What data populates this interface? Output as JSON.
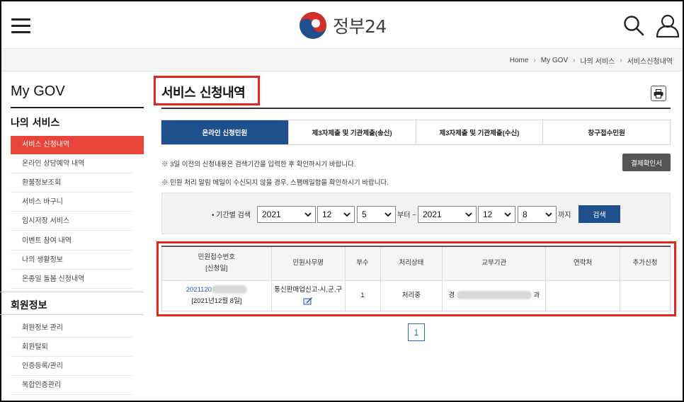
{
  "header": {
    "logo_text": "정부24",
    "colors": {
      "brand_red": "#d22f27",
      "brand_blue": "#1f4f8c"
    }
  },
  "breadcrumb": [
    "Home",
    "My GOV",
    "나의 서비스",
    "서비스신청내역"
  ],
  "sidebar": {
    "title": "My GOV",
    "section_service": "나의 서비스",
    "service_items": [
      {
        "label": "서비스 신청내역",
        "active": true
      },
      {
        "label": "온라인 상담예약 내역"
      },
      {
        "label": "환불정보조회"
      },
      {
        "label": "서비스 바구니"
      },
      {
        "label": "임시저장 서비스"
      },
      {
        "label": "이벤트 참여 내역"
      },
      {
        "label": "나의 생활정보"
      },
      {
        "label": "온종일 돌봄 신청내역"
      }
    ],
    "section_member": "회원정보",
    "member_items": [
      {
        "label": "회원정보 관리"
      },
      {
        "label": "회원탈퇴"
      },
      {
        "label": "인증등록/관리"
      },
      {
        "label": "복합인증관리"
      }
    ]
  },
  "main": {
    "page_title": "서비스 신청내역",
    "tabs": [
      {
        "label": "온라인 신청민원",
        "active": true
      },
      {
        "label": "제3자제출 및 기관제출(송신)"
      },
      {
        "label": "제3자제출 및 기관제출(수신)"
      },
      {
        "label": "창구접수민원"
      }
    ],
    "notice1": "※ 3일 이전의 신청내용은 검색기간을 입력한 후 확인하시기 바랍니다.",
    "notice2": "※ 민원 처리 알림 메일이 수신되지 않을 경우, 스팸메일함을 확인하시기 바랍니다.",
    "receipt_button": "결제확인서",
    "search": {
      "label": "• 기간별 검색",
      "from": {
        "year": "2021",
        "month": "12",
        "day": "5"
      },
      "from_suffix": "부터 ~",
      "to": {
        "year": "2021",
        "month": "12",
        "day": "8"
      },
      "to_suffix": "까지",
      "button": "검색"
    },
    "table": {
      "headers": [
        "민원접수번호",
        "[신청일]",
        "민원사무명",
        "부수",
        "처리상태",
        "교부기관",
        "연락처",
        "추가신청"
      ],
      "rows": [
        {
          "receipt_no": "2021120",
          "date": "[2021년12월 8일]",
          "service_name": "통신판매업신고-시,군,구",
          "copies": "1",
          "status": "처리중",
          "agency_prefix": "경",
          "agency_suffix": "과",
          "contact": "",
          "extra": ""
        }
      ]
    },
    "pagination": {
      "current": "1"
    }
  }
}
